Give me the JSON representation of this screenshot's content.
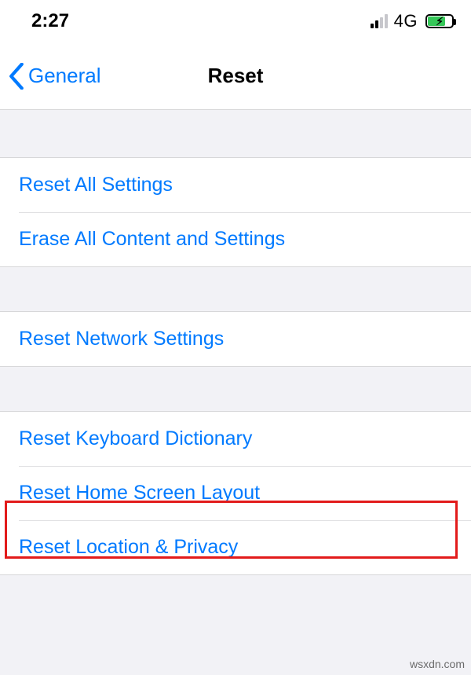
{
  "status": {
    "time": "2:27",
    "network_label": "4G"
  },
  "nav": {
    "back_label": "General",
    "title": "Reset"
  },
  "groups": [
    {
      "items": [
        {
          "key": "reset-all-settings",
          "label": "Reset All Settings"
        },
        {
          "key": "erase-all-content",
          "label": "Erase All Content and Settings"
        }
      ]
    },
    {
      "items": [
        {
          "key": "reset-network",
          "label": "Reset Network Settings"
        }
      ]
    },
    {
      "items": [
        {
          "key": "reset-keyboard",
          "label": "Reset Keyboard Dictionary"
        },
        {
          "key": "reset-home-layout",
          "label": "Reset Home Screen Layout"
        },
        {
          "key": "reset-location-privacy",
          "label": "Reset Location & Privacy"
        }
      ]
    }
  ],
  "watermark": "wsxdn.com"
}
